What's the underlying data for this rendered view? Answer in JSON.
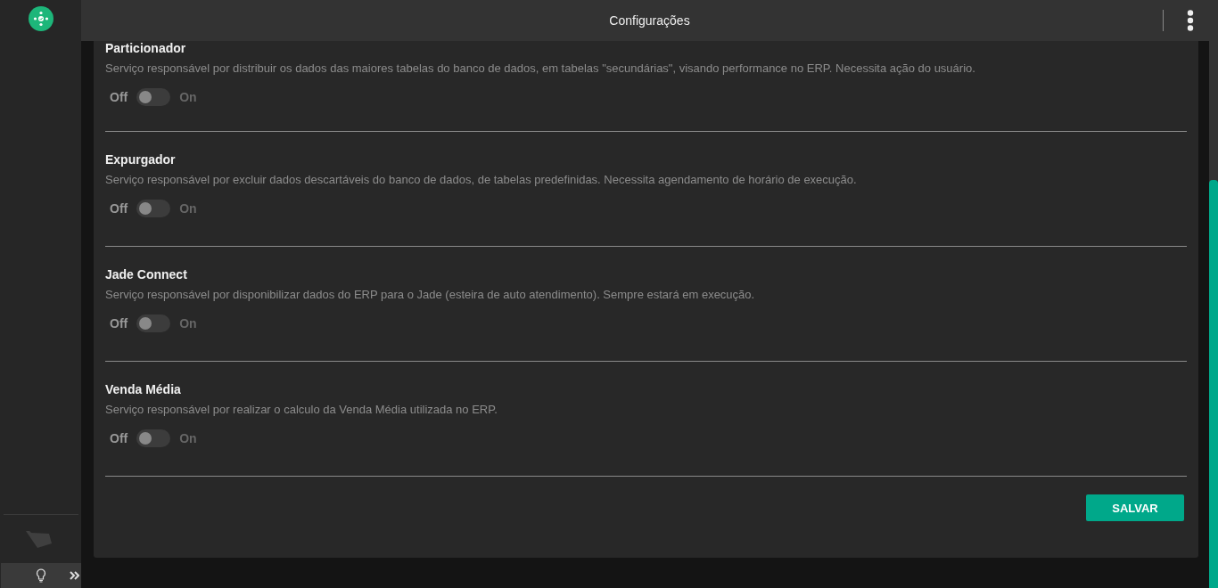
{
  "header": {
    "title": "Configurações"
  },
  "services": [
    {
      "name": "Particionador",
      "description": "Serviço responsável por distribuir os dados das maiores tabelas do banco de dados, em tabelas \"secundárias\", visando performance no ERP. Necessita ação do usuário.",
      "off_label": "Off",
      "on_label": "On",
      "on": false
    },
    {
      "name": "Expurgador",
      "description": "Serviço responsável por excluir dados descartáveis do banco de dados, de tabelas predefinidas. Necessita agendamento de horário de execução.",
      "off_label": "Off",
      "on_label": "On",
      "on": false
    },
    {
      "name": "Jade Connect",
      "description": "Serviço responsável por disponibilizar dados do ERP para o Jade (esteira de auto atendimento). Sempre estará em execução.",
      "off_label": "Off",
      "on_label": "On",
      "on": false
    },
    {
      "name": "Venda Média",
      "description": "Serviço responsável por realizar o calculo da Venda Média utilizada no ERP.",
      "off_label": "Off",
      "on_label": "On",
      "on": false
    }
  ],
  "save_button": "SALVAR"
}
